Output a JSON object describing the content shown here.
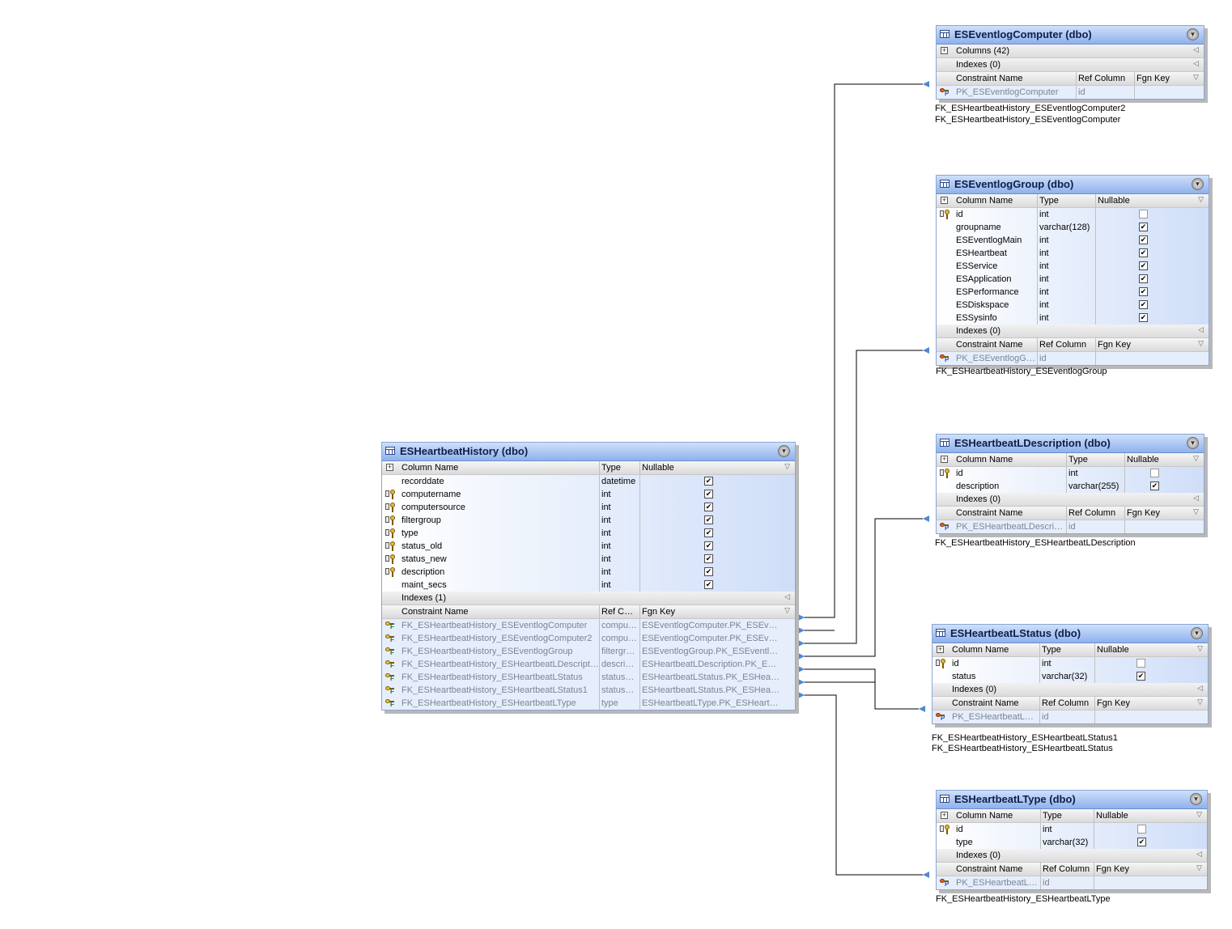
{
  "headers": {
    "column_name": "Column Name",
    "type": "Type",
    "nullable": "Nullable",
    "constraint_name": "Constraint Name",
    "ref_column": "Ref Column",
    "fgn_key": "Fgn Key"
  },
  "tables": {
    "hist": {
      "title": "ESHeartbeatHistory (dbo)",
      "ref_header": "Ref C…",
      "columns": [
        {
          "name": "recorddate",
          "type": "datetime",
          "key": false,
          "nullable": true
        },
        {
          "name": "computername",
          "type": "int",
          "key": true,
          "nullable": true
        },
        {
          "name": "computersource",
          "type": "int",
          "key": true,
          "nullable": true
        },
        {
          "name": "filtergroup",
          "type": "int",
          "key": true,
          "nullable": true
        },
        {
          "name": "type",
          "type": "int",
          "key": true,
          "nullable": true
        },
        {
          "name": "status_old",
          "type": "int",
          "key": true,
          "nullable": true
        },
        {
          "name": "status_new",
          "type": "int",
          "key": true,
          "nullable": true
        },
        {
          "name": "description",
          "type": "int",
          "key": true,
          "nullable": true
        },
        {
          "name": "maint_secs",
          "type": "int",
          "key": false,
          "nullable": true
        }
      ],
      "indexes": "Indexes (1)",
      "constraints": [
        {
          "name": "FK_ESHeartbeatHistory_ESEventlogComputer",
          "ref": "compu…",
          "fgn": "ESEventlogComputer.PK_ESEv…"
        },
        {
          "name": "FK_ESHeartbeatHistory_ESEventlogComputer2",
          "ref": "compu…",
          "fgn": "ESEventlogComputer.PK_ESEv…"
        },
        {
          "name": "FK_ESHeartbeatHistory_ESEventlogGroup",
          "ref": "filtergr…",
          "fgn": "ESEventlogGroup.PK_ESEventl…"
        },
        {
          "name": "FK_ESHeartbeatHistory_ESHeartbeatLDescription",
          "ref": "descri…",
          "fgn": "ESHeartbeatLDescription.PK_E…"
        },
        {
          "name": "FK_ESHeartbeatHistory_ESHeartbeatLStatus",
          "ref": "status…",
          "fgn": "ESHeartbeatLStatus.PK_ESHea…"
        },
        {
          "name": "FK_ESHeartbeatHistory_ESHeartbeatLStatus1",
          "ref": "status…",
          "fgn": "ESHeartbeatLStatus.PK_ESHea…"
        },
        {
          "name": "FK_ESHeartbeatHistory_ESHeartbeatLType",
          "ref": "type",
          "fgn": "ESHeartbeatLType.PK_ESHeart…"
        }
      ]
    },
    "computer": {
      "title": "ESEventlogComputer (dbo)",
      "columns_collapsed": "Columns (42)",
      "indexes": "Indexes (0)",
      "constraints": [
        {
          "name": "PK_ESEventlogComputer",
          "ref": "id",
          "fgn": ""
        }
      ],
      "fk_labels": [
        "FK_ESHeartbeatHistory_ESEventlogComputer2",
        "FK_ESHeartbeatHistory_ESEventlogComputer"
      ]
    },
    "group": {
      "title": "ESEventlogGroup (dbo)",
      "columns": [
        {
          "name": "id",
          "type": "int",
          "key": true,
          "nullable": false
        },
        {
          "name": "groupname",
          "type": "varchar(128)",
          "key": false,
          "nullable": true
        },
        {
          "name": "ESEventlogMain",
          "type": "int",
          "key": false,
          "nullable": true
        },
        {
          "name": "ESHeartbeat",
          "type": "int",
          "key": false,
          "nullable": true
        },
        {
          "name": "ESService",
          "type": "int",
          "key": false,
          "nullable": true
        },
        {
          "name": "ESApplication",
          "type": "int",
          "key": false,
          "nullable": true
        },
        {
          "name": "ESPerformance",
          "type": "int",
          "key": false,
          "nullable": true
        },
        {
          "name": "ESDiskspace",
          "type": "int",
          "key": false,
          "nullable": true
        },
        {
          "name": "ESSysinfo",
          "type": "int",
          "key": false,
          "nullable": true
        }
      ],
      "indexes": "Indexes (0)",
      "constraints": [
        {
          "name": "PK_ESEventlogGr…",
          "ref": "id",
          "fgn": ""
        }
      ],
      "fk_labels": [
        "FK_ESHeartbeatHistory_ESEventlogGroup"
      ]
    },
    "ldesc": {
      "title": "ESHeartbeatLDescription (dbo)",
      "columns": [
        {
          "name": "id",
          "type": "int",
          "key": true,
          "nullable": false
        },
        {
          "name": "description",
          "type": "varchar(255)",
          "key": false,
          "nullable": true
        }
      ],
      "indexes": "Indexes (0)",
      "constraints": [
        {
          "name": "PK_ESHeartbeatLDescrip…",
          "ref": "id",
          "fgn": ""
        }
      ],
      "fk_labels": [
        "FK_ESHeartbeatHistory_ESHeartbeatLDescription"
      ]
    },
    "lstatus": {
      "title": "ESHeartbeatLStatus (dbo)",
      "columns": [
        {
          "name": "id",
          "type": "int",
          "key": true,
          "nullable": false
        },
        {
          "name": "status",
          "type": "varchar(32)",
          "key": false,
          "nullable": true
        }
      ],
      "indexes": "Indexes (0)",
      "constraints": [
        {
          "name": "PK_ESHeartbeatLS…",
          "ref": "id",
          "fgn": ""
        }
      ],
      "fk_labels": [
        "FK_ESHeartbeatHistory_ESHeartbeatLStatus1",
        "FK_ESHeartbeatHistory_ESHeartbeatLStatus"
      ]
    },
    "ltype": {
      "title": "ESHeartbeatLType (dbo)",
      "columns": [
        {
          "name": "id",
          "type": "int",
          "key": true,
          "nullable": false
        },
        {
          "name": "type",
          "type": "varchar(32)",
          "key": false,
          "nullable": true
        }
      ],
      "indexes": "Indexes (0)",
      "constraints": [
        {
          "name": "PK_ESHeartbeatL…",
          "ref": "id",
          "fgn": ""
        }
      ],
      "fk_labels": [
        "FK_ESHeartbeatHistory_ESHeartbeatLType"
      ]
    }
  }
}
